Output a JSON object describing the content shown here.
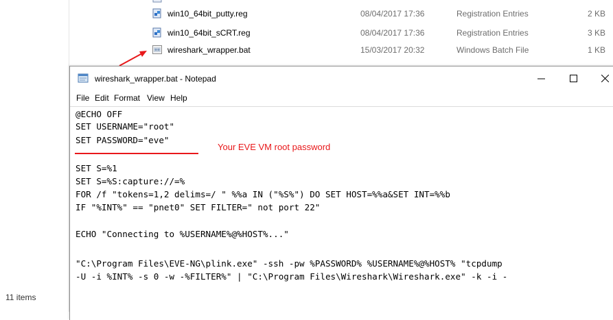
{
  "explorer": {
    "files": [
      {
        "name": "win10_64bit_putty.reg",
        "date": "08/04/2017 17:36",
        "type": "Registration Entries",
        "size": "2 KB"
      },
      {
        "name": "win10_64bit_sCRT.reg",
        "date": "08/04/2017 17:36",
        "type": "Registration Entries",
        "size": "3 KB"
      },
      {
        "name": "wireshark_wrapper.bat",
        "date": "15/03/2017 20:32",
        "type": "Windows Batch File",
        "size": "1 KB"
      }
    ],
    "status_count": "11 items"
  },
  "notepad": {
    "title": "wireshark_wrapper.bat - Notepad",
    "menu": [
      "File",
      "Edit",
      "Format",
      "View",
      "Help"
    ],
    "lines": [
      "@ECHO OFF",
      "SET USERNAME=\"root\"",
      "SET PASSWORD=\"eve\"",
      "",
      "SET S=%1",
      "SET S=%S:capture://=%",
      "FOR /f \"tokens=1,2 delims=/ \" %%a IN (\"%S%\") DO SET HOST=%%a&SET INT=%%b",
      "IF \"%INT%\" == \"pnet0\" SET FILTER=\" not port 22\"",
      "",
      "ECHO \"Connecting to %USERNAME%@%HOST%...\"",
      "",
      "\"C:\\Program Files\\EVE-NG\\plink.exe\" -ssh -pw %PASSWORD% %USERNAME%@%HOST% \"tcpdump",
      "-U -i %INT% -s 0 -w -%FILTER%\" | \"C:\\Program Files\\Wireshark\\Wireshark.exe\" -k -i -"
    ],
    "annotation": "Your EVE VM root password"
  },
  "colors": {
    "annotation": "#e8181a",
    "arrow": "#e8181a"
  }
}
